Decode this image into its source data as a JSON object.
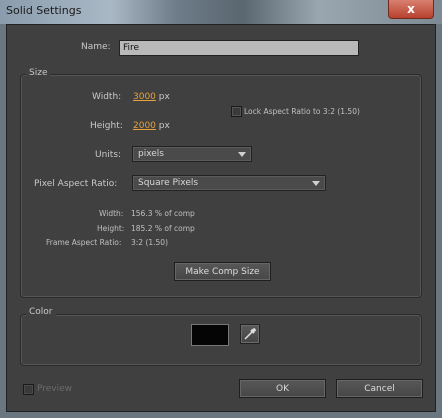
{
  "window": {
    "title": "Solid Settings",
    "close_glyph": "x"
  },
  "name": {
    "label": "Name:",
    "value": "Fire"
  },
  "size": {
    "group_title": "Size",
    "width": {
      "label": "Width:",
      "value": "3000",
      "unit": "px"
    },
    "height": {
      "label": "Height:",
      "value": "2000",
      "unit": "px"
    },
    "lock_aspect": {
      "label": "Lock Aspect Ratio to 3:2 (1.50)",
      "checked": false
    },
    "units": {
      "label": "Units:",
      "selected": "pixels"
    },
    "pixel_aspect": {
      "label": "Pixel Aspect Ratio:",
      "selected": "Square Pixels"
    },
    "info": {
      "width_label": "Width:",
      "width_value": "156.3 % of comp",
      "height_label": "Height:",
      "height_value": "185.2 % of comp",
      "frame_label": "Frame Aspect Ratio:",
      "frame_value": "3:2 (1.50)"
    },
    "make_comp_size_label": "Make Comp Size"
  },
  "color": {
    "group_title": "Color",
    "swatch_color": "#050505",
    "eyedropper_icon": "eyedropper-icon"
  },
  "footer": {
    "preview_label": "Preview",
    "ok_label": "OK",
    "cancel_label": "Cancel"
  }
}
